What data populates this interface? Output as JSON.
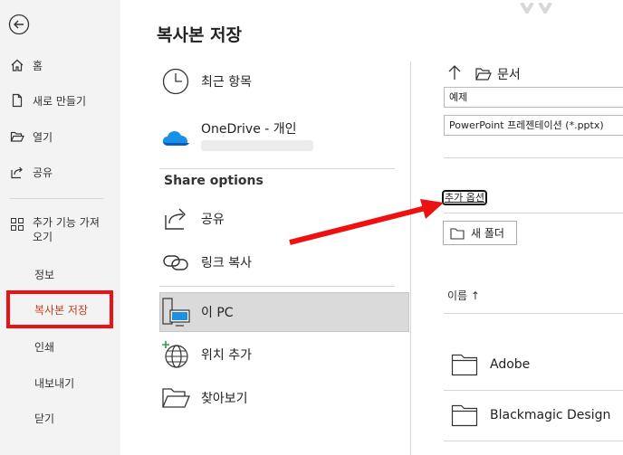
{
  "nav": {
    "back_icon": "back-arrow-icon",
    "items": [
      {
        "label": "홈",
        "icon": "home-icon"
      },
      {
        "label": "새로 만들기",
        "icon": "new-document-icon"
      },
      {
        "label": "열기",
        "icon": "open-folder-icon"
      },
      {
        "label": "공유",
        "icon": "share-icon"
      },
      {
        "label": "추가 기능 가져오기",
        "icon": "addins-grid-icon"
      },
      {
        "label": "정보"
      },
      {
        "label": "복사본 저장",
        "selected": true
      },
      {
        "label": "인쇄"
      },
      {
        "label": "내보내기"
      },
      {
        "label": "닫기"
      }
    ],
    "selected_color": "#c43e1c"
  },
  "main": {
    "title": "복사본 저장",
    "locations": [
      {
        "label": "최근 항목",
        "icon": "clock-icon"
      },
      {
        "label": "OneDrive - 개인",
        "icon": "onedrive-cloud-icon"
      }
    ],
    "share_title": "Share options",
    "share_items": [
      {
        "label": "공유",
        "icon": "share-arrow-icon"
      },
      {
        "label": "링크 복사",
        "icon": "link-icon"
      }
    ],
    "places": [
      {
        "label": "이 PC",
        "icon": "this-pc-icon",
        "selected": true
      },
      {
        "label": "위치 추가",
        "icon": "add-location-globe-icon"
      },
      {
        "label": "찾아보기",
        "icon": "browse-folder-icon"
      }
    ]
  },
  "right": {
    "breadcrumb": "문서",
    "filename": "예제",
    "filetype": "PowerPoint 프레젠테이션 (*.pptx)",
    "more_options": "추가 옵션",
    "new_folder": "새 폴더",
    "sort_header": "이름 ↑",
    "folders": [
      {
        "name": "Adobe"
      },
      {
        "name": "Blackmagic Design"
      }
    ]
  },
  "annotation": {
    "highlight_color": "#ee1111"
  }
}
